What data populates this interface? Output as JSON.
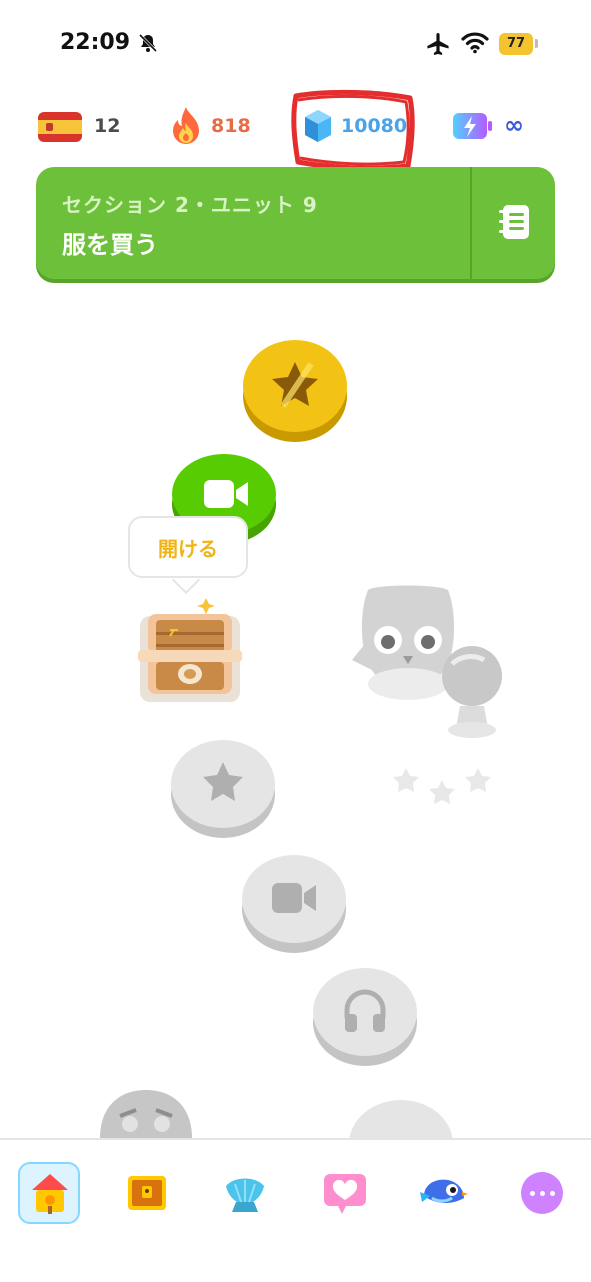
{
  "status_bar": {
    "time": "22:09",
    "battery": "77"
  },
  "stats": {
    "flag_count": "12",
    "streak": "818",
    "gems": "10080",
    "energy": "∞"
  },
  "unit_banner": {
    "subtitle": "セクション 2・ユニット 9",
    "title": "服を買う"
  },
  "chest_tooltip": "開ける",
  "colors": {
    "green": "#6dc13a",
    "gold": "#f0b416",
    "streak": "#e66c47",
    "gems": "#4aa3e8",
    "energy": "#3b5bdb"
  },
  "tabs": [
    "home-icon",
    "treasure-chest-icon",
    "shell-icon",
    "heart-icon",
    "bird-icon",
    "more-icon"
  ]
}
